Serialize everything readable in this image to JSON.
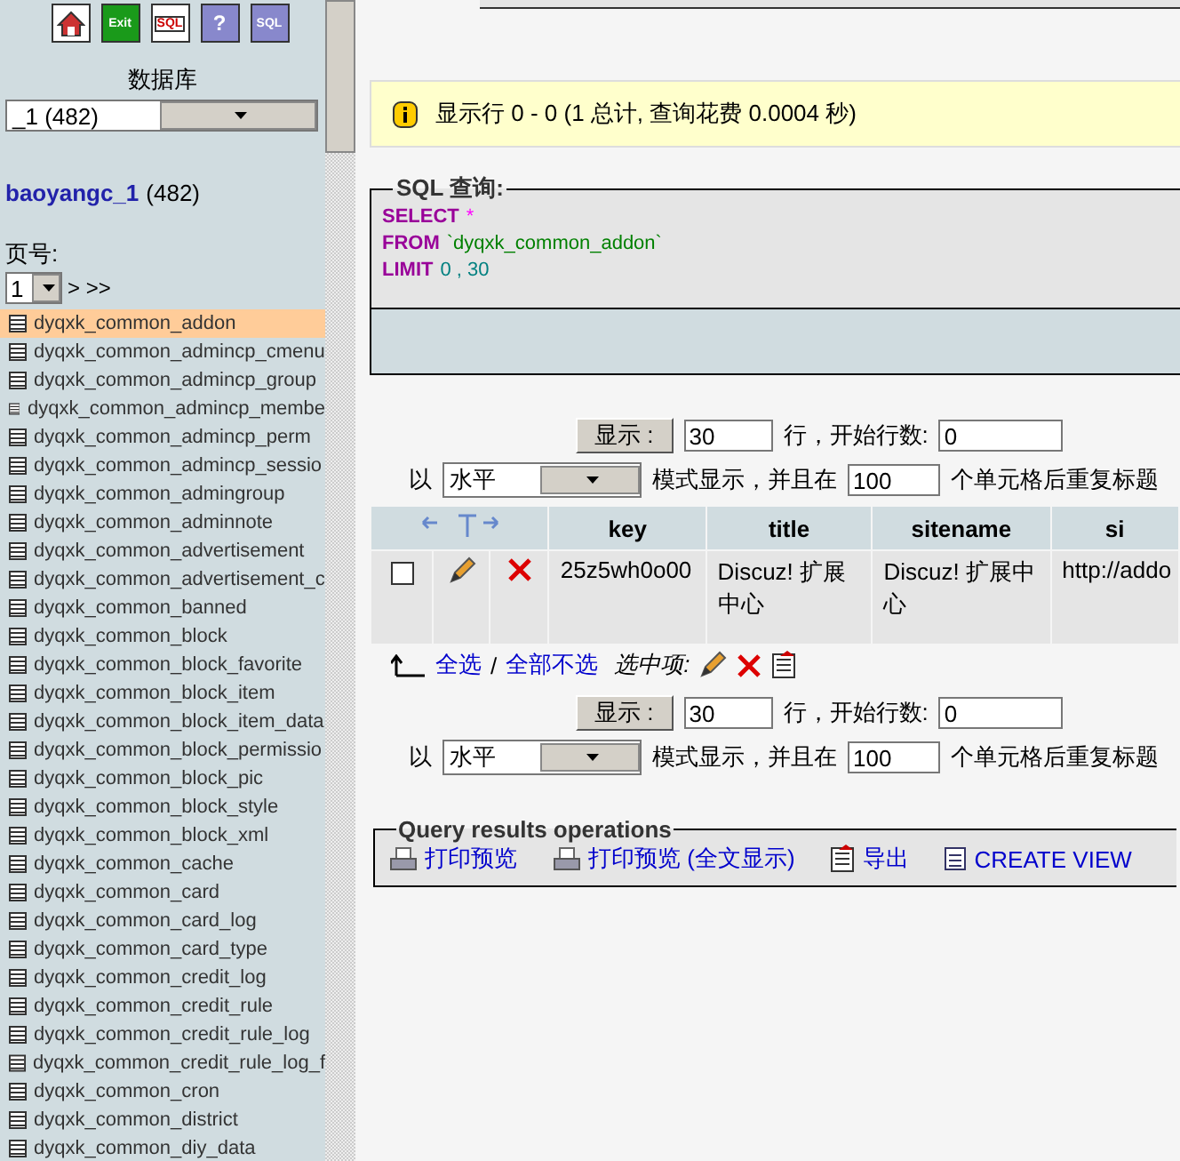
{
  "sidebar": {
    "toolbar": [
      {
        "kind": "home"
      },
      {
        "kind": "exit",
        "label": "Exit"
      },
      {
        "kind": "sql",
        "label": "SQL"
      },
      {
        "kind": "help",
        "label": "?"
      },
      {
        "kind": "query",
        "label": "SQL"
      }
    ],
    "database_label": "数据库",
    "database_select": "_1 (482)",
    "db_name": "baoyangc_1",
    "db_count": "(482)",
    "page_label": "页号:",
    "page_select": "1",
    "page_nav": "> >>",
    "tables": [
      {
        "name": "dyqxk_common_addon",
        "selected": true
      },
      {
        "name": "dyqxk_common_admincp_cmenu",
        "selected": false
      },
      {
        "name": "dyqxk_common_admincp_group",
        "selected": false
      },
      {
        "name": "dyqxk_common_admincp_membe",
        "selected": false
      },
      {
        "name": "dyqxk_common_admincp_perm",
        "selected": false
      },
      {
        "name": "dyqxk_common_admincp_sessio",
        "selected": false
      },
      {
        "name": "dyqxk_common_admingroup",
        "selected": false
      },
      {
        "name": "dyqxk_common_adminnote",
        "selected": false
      },
      {
        "name": "dyqxk_common_advertisement",
        "selected": false
      },
      {
        "name": "dyqxk_common_advertisement_c",
        "selected": false
      },
      {
        "name": "dyqxk_common_banned",
        "selected": false
      },
      {
        "name": "dyqxk_common_block",
        "selected": false
      },
      {
        "name": "dyqxk_common_block_favorite",
        "selected": false
      },
      {
        "name": "dyqxk_common_block_item",
        "selected": false
      },
      {
        "name": "dyqxk_common_block_item_data",
        "selected": false
      },
      {
        "name": "dyqxk_common_block_permissio",
        "selected": false
      },
      {
        "name": "dyqxk_common_block_pic",
        "selected": false
      },
      {
        "name": "dyqxk_common_block_style",
        "selected": false
      },
      {
        "name": "dyqxk_common_block_xml",
        "selected": false
      },
      {
        "name": "dyqxk_common_cache",
        "selected": false
      },
      {
        "name": "dyqxk_common_card",
        "selected": false
      },
      {
        "name": "dyqxk_common_card_log",
        "selected": false
      },
      {
        "name": "dyqxk_common_card_type",
        "selected": false
      },
      {
        "name": "dyqxk_common_credit_log",
        "selected": false
      },
      {
        "name": "dyqxk_common_credit_rule",
        "selected": false
      },
      {
        "name": "dyqxk_common_credit_rule_log",
        "selected": false
      },
      {
        "name": "dyqxk_common_credit_rule_log_f",
        "selected": false
      },
      {
        "name": "dyqxk_common_cron",
        "selected": false
      },
      {
        "name": "dyqxk_common_district",
        "selected": false
      },
      {
        "name": "dyqxk_common_diy_data",
        "selected": false
      }
    ]
  },
  "main": {
    "info": "显示行  0 - 0 (1 总计, 查询花费  0.0004 秒)",
    "sql": {
      "legend": "SQL 查询:",
      "lines": [
        [
          {
            "kind": "keyword",
            "text": "SELECT"
          },
          {
            "kind": "operator",
            "text": "*"
          }
        ],
        [
          {
            "kind": "keyword",
            "text": "FROM"
          },
          {
            "kind": "identifier",
            "text": "`dyqxk_common_addon`"
          }
        ],
        [
          {
            "kind": "keyword",
            "text": "LIMIT"
          },
          {
            "kind": "number",
            "text": "0 , 30"
          }
        ]
      ]
    },
    "navigation": [
      {
        "show_button": "显示 :",
        "rows": "30",
        "rows_text": "行，开始行数:",
        "start": "0",
        "prefix": "以",
        "mode": "水平",
        "mode_text": "模式显示，并且在",
        "repeat": "100",
        "repeat_text": "个单元格后重复标题"
      },
      {
        "show_button": "显示 :",
        "rows": "30",
        "rows_text": "行，开始行数:",
        "start": "0",
        "prefix": "以",
        "mode": "水平",
        "mode_text": "模式显示，并且在",
        "repeat": "100",
        "repeat_text": "个单元格后重复标题"
      }
    ],
    "table": {
      "columns": [
        "key",
        "title",
        "sitename",
        "si"
      ],
      "rows": [
        {
          "checked": false,
          "cells": [
            "25z5wh0o00",
            "Discuz! 扩展中心",
            "Discuz! 扩展中心",
            "http://addo"
          ]
        }
      ]
    },
    "bulk": {
      "check_all": "全选",
      "separator": "/",
      "uncheck_all": "全部不选",
      "with_selected": "选中项:"
    },
    "operations": {
      "legend": "Query results operations",
      "items": [
        {
          "kind": "print",
          "label": "打印预览"
        },
        {
          "kind": "print",
          "label": "打印预览 (全文显示)"
        },
        {
          "kind": "export",
          "label": "导出"
        },
        {
          "kind": "view",
          "label": "CREATE VIEW"
        }
      ]
    }
  }
}
